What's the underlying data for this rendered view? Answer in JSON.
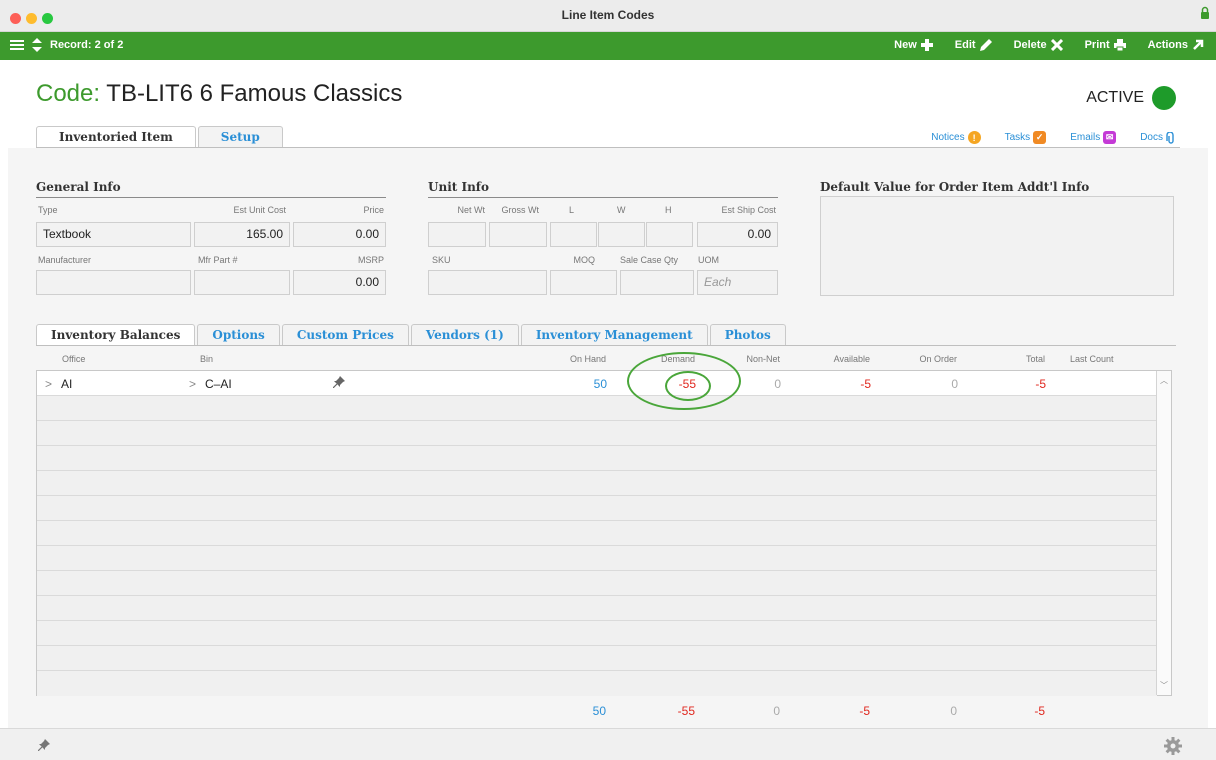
{
  "window": {
    "title": "Line Item Codes"
  },
  "toolbar": {
    "record_label": "Record: 2 of 2",
    "buttons": [
      {
        "label": "New",
        "icon": "plus-icon"
      },
      {
        "label": "Edit",
        "icon": "pencil-icon"
      },
      {
        "label": "Delete",
        "icon": "x-icon"
      },
      {
        "label": "Print",
        "icon": "printer-icon"
      },
      {
        "label": "Actions",
        "icon": "arrow-icon"
      }
    ]
  },
  "header": {
    "code_label": "Code:",
    "code_value": "TB-LIT6 6 Famous Classics",
    "status": "ACTIVE",
    "status_color": "#1e9b2a"
  },
  "main_tabs": [
    "Inventoried Item",
    "Setup"
  ],
  "side_links": {
    "notices": "Notices",
    "tasks": "Tasks",
    "emails": "Emails",
    "docs": "Docs"
  },
  "general_info": {
    "title": "General Info",
    "type_label": "Type",
    "type_value": "Textbook",
    "est_unit_cost_label": "Est Unit Cost",
    "est_unit_cost_value": "165.00",
    "price_label": "Price",
    "price_value": "0.00",
    "manufacturer_label": "Manufacturer",
    "manufacturer_value": "",
    "mfr_part_label": "Mfr Part #",
    "mfr_part_value": "",
    "msrp_label": "MSRP",
    "msrp_value": "0.00"
  },
  "unit_info": {
    "title": "Unit Info",
    "net_wt_label": "Net Wt",
    "gross_wt_label": "Gross Wt",
    "l_label": "L",
    "w_label": "W",
    "h_label": "H",
    "est_ship_cost_label": "Est Ship Cost",
    "est_ship_cost_value": "0.00",
    "sku_label": "SKU",
    "moq_label": "MOQ",
    "sale_case_qty_label": "Sale Case Qty",
    "uom_label": "UOM",
    "uom_placeholder": "Each"
  },
  "default_value": {
    "title": "Default Value for Order Item Addt'l Info"
  },
  "sub_tabs": [
    "Inventory Balances",
    "Options",
    "Custom Prices",
    "Vendors (1)",
    "Inventory Management",
    "Photos"
  ],
  "balances": {
    "columns": [
      "Office",
      "Bin",
      "On Hand",
      "Demand",
      "Non-Net",
      "Available",
      "On Order",
      "Total",
      "Last Count"
    ],
    "rows": [
      {
        "office": "AI",
        "bin": "C–AI",
        "on_hand": "50",
        "demand": "-55",
        "non_net": "0",
        "available": "-5",
        "on_order": "0",
        "total": "-5",
        "last_count": ""
      }
    ],
    "totals": {
      "on_hand": "50",
      "demand": "-55",
      "non_net": "0",
      "available": "-5",
      "on_order": "0",
      "total": "-5"
    }
  },
  "colors": {
    "toolbar": "#3d9a2d",
    "link": "#2a8fd6",
    "negative": "#e0271e",
    "annotation": "#4aa63a"
  }
}
